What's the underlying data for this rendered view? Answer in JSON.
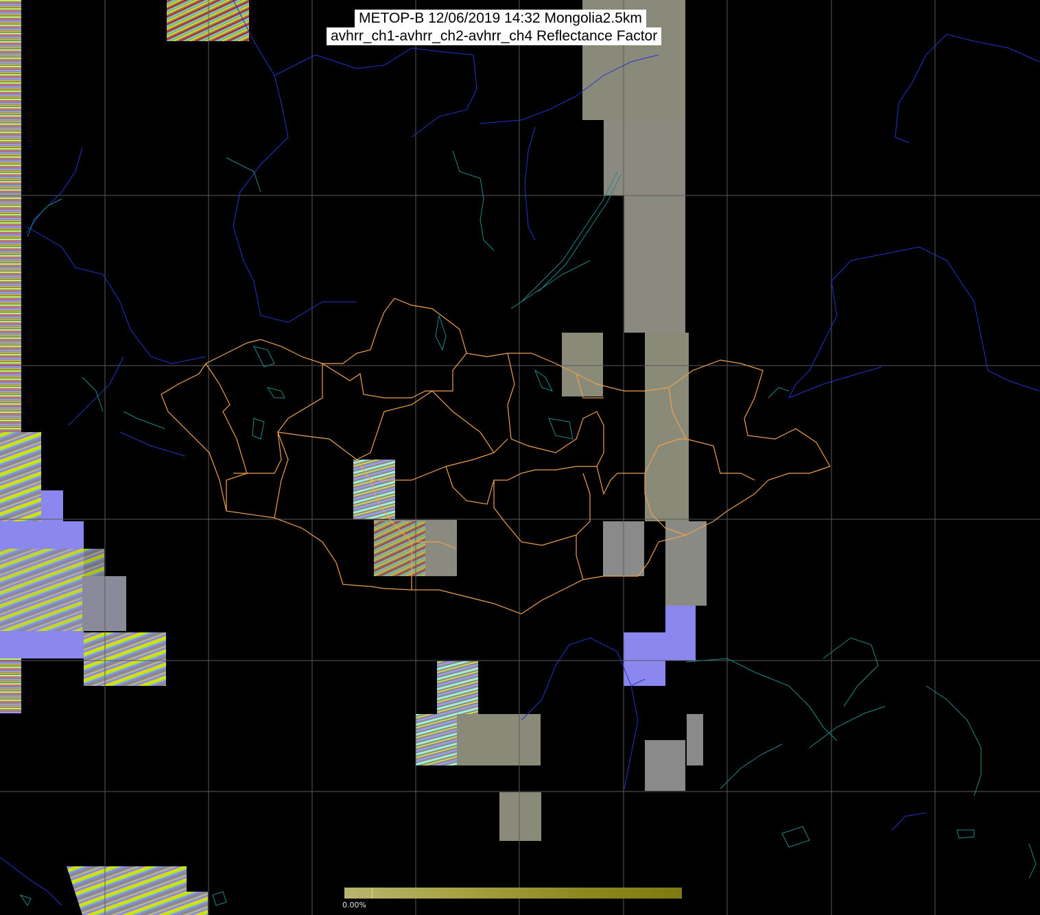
{
  "title": {
    "line1": "METOP-B 12/06/2019 14:32 Mongolia2.5km",
    "line2": "avhrr_ch1-avhrr_ch2-avhrr_ch4 Reflectance Factor"
  },
  "colorbar": {
    "label": "0.00%",
    "start_color": "#b9b571",
    "end_color": "#7e7a12"
  },
  "colors": {
    "background": "#000000",
    "graticule": "#5a5a5a",
    "coastlines_rivers": "#2233cc",
    "lakes_shoreline": "#1f8a8a",
    "admin_borders": "#f0a050",
    "swath_gray": "#8a8a78",
    "swath_blue": "#8a88ee"
  },
  "icons": {
    "map": "satellite-reflectance-map",
    "colorbar": "color-scale-bar"
  }
}
